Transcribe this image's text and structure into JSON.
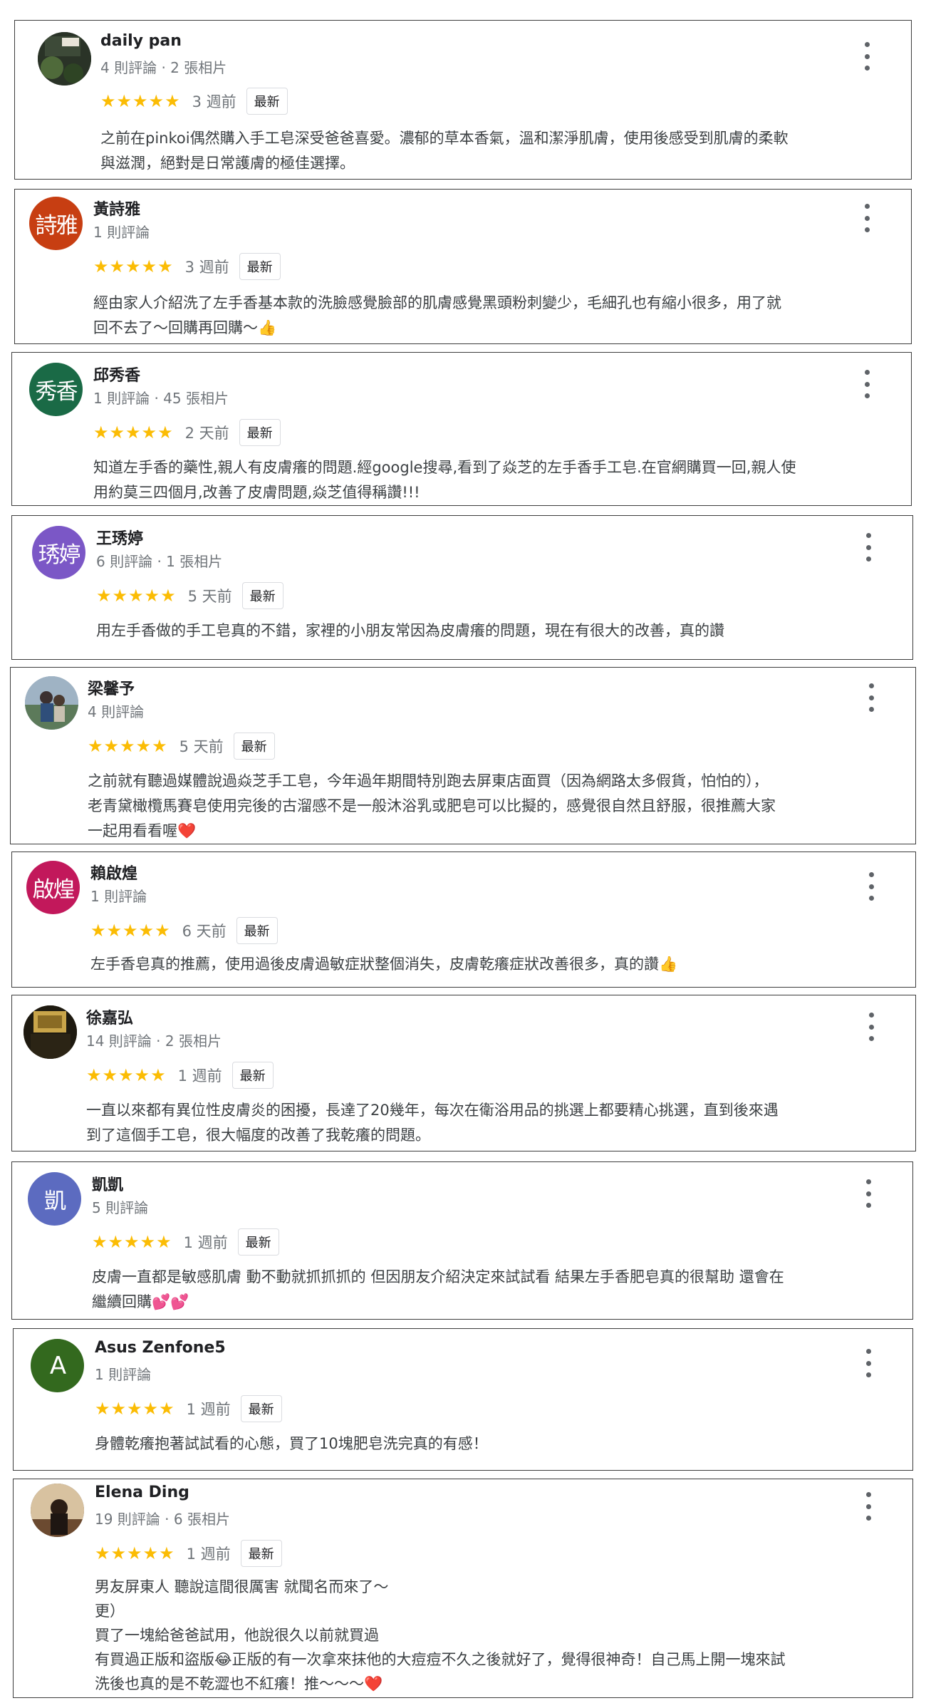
{
  "labels": {
    "latest": "最新"
  },
  "colors": {
    "star": "#fbbc04",
    "border": "#3c3c3c",
    "meta": "#70757a"
  },
  "reviews": [
    {
      "name": "daily pan",
      "meta": "4 則評論 · 2 張相片",
      "stars": "★★★★★",
      "ago": "3 週前",
      "text": "之前在pinkoi偶然購入手工皂深受爸爸喜愛。濃郁的草本香氣，溫和潔淨肌膚，使用後感受到肌膚的柔軟\n與滋潤，絕對是日常護膚的極佳選擇。",
      "avatar": "photo",
      "avatar_color": "#2f3a2b"
    },
    {
      "name": "黃詩雅",
      "meta": "1 則評論",
      "stars": "★★★★★",
      "ago": "3 週前",
      "text": "經由家人介紹洗了左手香基本款的洗臉感覺臉部的肌膚感覺黑頭粉刺變少，毛細孔也有縮小很多，用了就\n回不去了～回購再回購～👍",
      "avatar": "詩雅",
      "avatar_color": "#c73e12"
    },
    {
      "name": "邱秀香",
      "meta": "1 則評論 · 45 張相片",
      "stars": "★★★★★",
      "ago": "2 天前",
      "text": "知道左手香的藥性,親人有皮膚癢的問題.經google搜尋,看到了焱芝的左手香手工皂.在官網購買一回,親人使\n用約莫三四個月,改善了皮膚問題,焱芝值得稱讚!!!",
      "avatar": "秀香",
      "avatar_color": "#1a6a46"
    },
    {
      "name": "王琇婷",
      "meta": "6 則評論 · 1 張相片",
      "stars": "★★★★★",
      "ago": "5 天前",
      "text": "用左手香做的手工皂真的不錯，家裡的小朋友常因為皮膚癢的問題，現在有很大的改善，真的讚",
      "avatar": "琇婷",
      "avatar_color": "#7b57c6"
    },
    {
      "name": "梁馨予",
      "meta": "4 則評論",
      "stars": "★★★★★",
      "ago": "5 天前",
      "text": "之前就有聽過媒體說過焱芝手工皂，今年過年期間特別跑去屏東店面買（因為網路太多假貨，怕怕的），\n老青黛橄欖馬賽皂使用完後的古溜感不是一般沐浴乳或肥皂可以比擬的，感覺很自然且舒服，很推薦大家\n一起用看看喔❤️",
      "avatar": "photo",
      "avatar_color": "#7a8fa8"
    },
    {
      "name": "賴啟煌",
      "meta": "1 則評論",
      "stars": "★★★★★",
      "ago": "6 天前",
      "text": "左手香皂真的推薦，使用過後皮膚過敏症狀整個消失，皮膚乾癢症狀改善很多，真的讚👍",
      "avatar": "啟煌",
      "avatar_color": "#c2185b"
    },
    {
      "name": "徐嘉弘",
      "meta": "14 則評論 · 2 張相片",
      "stars": "★★★★★",
      "ago": "1 週前",
      "text": "一直以來都有異位性皮膚炎的困擾，長達了20幾年，每次在衛浴用品的挑選上都要精心挑選，直到後來遇\n到了這個手工皂，很大幅度的改善了我乾癢的問題。",
      "avatar": "photo",
      "avatar_color": "#3b2f12"
    },
    {
      "name": "凱凱",
      "meta": "5 則評論",
      "stars": "★★★★★",
      "ago": "1 週前",
      "text": "皮膚一直都是敏感肌膚 動不動就抓抓抓的 但因朋友介紹決定來試試看 結果左手香肥皂真的很幫助 還會在\n繼續回購💕💕",
      "avatar": "凱",
      "avatar_color": "#5c6bc0"
    },
    {
      "name": "Asus Zenfone5",
      "meta": "1 則評論",
      "stars": "★★★★★",
      "ago": "1 週前",
      "text": "身體乾癢抱著試試看的心態，買了10塊肥皂洗完真的有感！",
      "avatar": "A",
      "avatar_color": "#33691e"
    },
    {
      "name": "Elena Ding",
      "meta": "19 則評論 · 6 張相片",
      "stars": "★★★★★",
      "ago": "1 週前",
      "text": "男友屏東人 聽說這間很厲害 就聞名而來了～\n更）\n買了一塊給爸爸試用，他說很久以前就買過\n有買過正版和盜版😂正版的有一次拿來抹他的大痘痘不久之後就好了，覺得很神奇！自己馬上開一塊來試\n洗後也真的是不乾澀也不紅癢！推～～～❤️",
      "avatar": "photo",
      "avatar_color": "#5a4030"
    }
  ]
}
